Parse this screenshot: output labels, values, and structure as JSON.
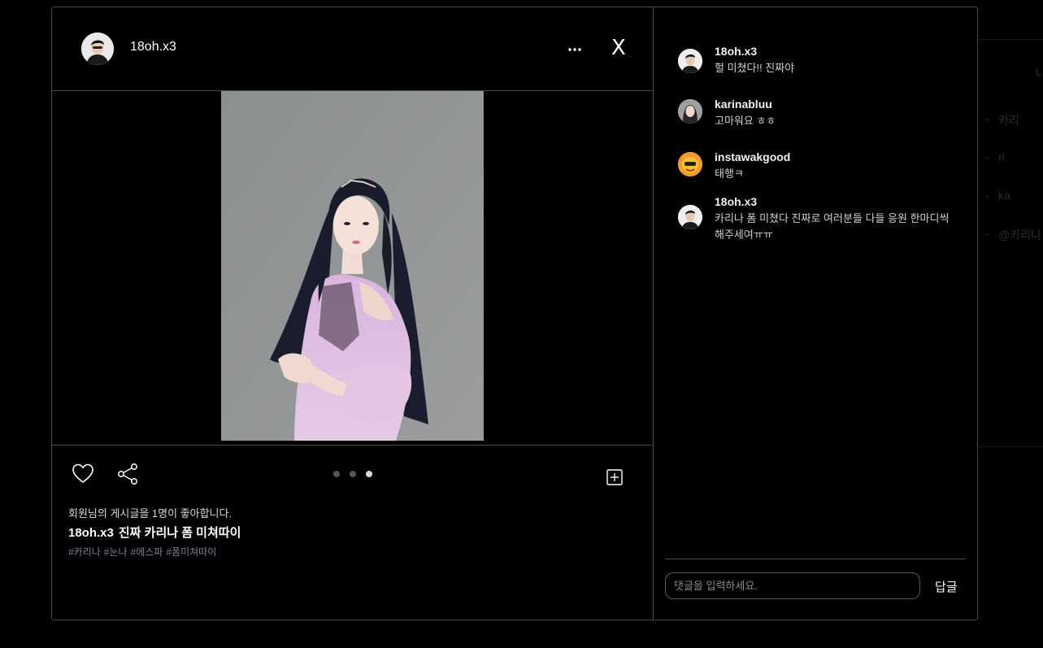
{
  "background_page": {
    "side_letter": "L",
    "items": [
      "카리",
      "ri",
      "ka",
      "@카리나"
    ]
  },
  "post": {
    "author": "18oh.x3",
    "more_icon": "more-horizontal-icon",
    "close_label": "X",
    "carousel": {
      "count": 3,
      "active": 3
    },
    "likes_text": "회원님의 게시글을 1명이 좋아합니다.",
    "caption_user": "18oh.x3",
    "caption_text": "진짜 카리나 폼 미쳐따이",
    "hashtags": [
      "#카리나",
      "#눈나",
      "#에스파",
      "#폼미쳐따이"
    ]
  },
  "comments": [
    {
      "user": "18oh.x3",
      "text": "헐 미쳤다!! 진짜야",
      "avatar": "person-dark"
    },
    {
      "user": "karinabluu",
      "text": "고마워요 ㅎㅎ",
      "avatar": "person-photo"
    },
    {
      "user": "instawakgood",
      "text": "태행ㅋ",
      "avatar": "cartoon-orange"
    },
    {
      "user": "18oh.x3",
      "text": "카리나 폼 미쳤다 진짜로 여러분들 다들 응원 한마디씩 해주세여ㅠㅠ",
      "avatar": "person-dark"
    }
  ],
  "comment_box": {
    "placeholder": "댓글을 입력하세요.",
    "submit_label": "답글"
  },
  "colors": {
    "background": "#000000",
    "border": "#4a4a4a",
    "hashtag": "#7f7f92",
    "dot_inactive": "#555555",
    "dot_active": "#d9d9d9"
  }
}
